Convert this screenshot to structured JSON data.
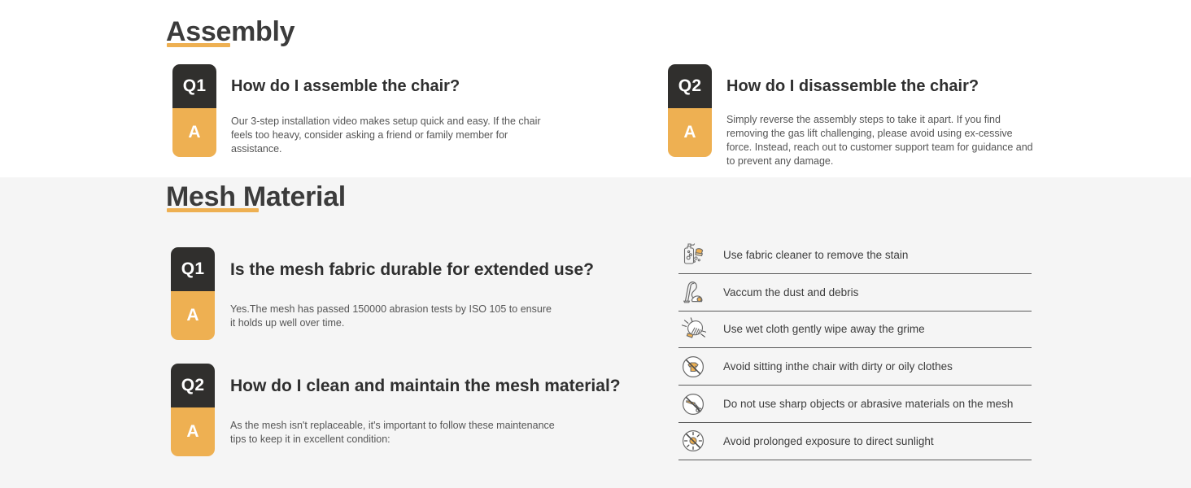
{
  "sections": [
    {
      "id": "assembly",
      "title": "Assembly",
      "accent_color": "#eeb052",
      "background": "#ffffff",
      "cards": [
        {
          "q_label": "Q1",
          "a_label": "A",
          "question": "How do I assemble the chair?",
          "answer": "Our 3-step installation video makes setup quick and easy. If the chair feels too heavy, consider asking a friend or family member for assistance."
        },
        {
          "q_label": "Q2",
          "a_label": "A",
          "question": "How do I disassemble the chair?",
          "answer": "Simply reverse the assembly steps to take it apart. If you find removing the gas lift challenging, please avoid using ex-cessive force. Instead, reach out to  customer support team for guidance and to prevent any damage."
        }
      ]
    },
    {
      "id": "mesh-material",
      "title": "Mesh Material",
      "accent_color": "#eeb052",
      "background": "#f5f5f5",
      "cards": [
        {
          "q_label": "Q1",
          "a_label": "A",
          "question": "Is the mesh fabric durable for extended use?",
          "answer": "Yes.The mesh has passed 150000 abrasion tests by ISO 105 to ensure it holds up well over time."
        },
        {
          "q_label": "Q2",
          "a_label": "A",
          "question": "How do I  clean and maintain the mesh material?",
          "answer": "As the mesh isn't replaceable, it's important to follow these maintenance tips to keep it in excellent condition:"
        }
      ]
    }
  ],
  "maintenance_tips": [
    {
      "icon": "spray-bottle-sponge-icon",
      "label": "Use fabric cleaner to remove the stain"
    },
    {
      "icon": "vacuum-cleaner-icon",
      "label": "Vaccum the dust and debris"
    },
    {
      "icon": "hand-wiping-cloth-icon",
      "label": "Use wet cloth gently wipe away the grime"
    },
    {
      "icon": "no-dirty-clothes-icon",
      "label": "Avoid sitting inthe chair with dirty or oily clothes"
    },
    {
      "icon": "no-sharp-objects-icon",
      "label": "Do not use sharp objects or abrasive materials on the mesh"
    },
    {
      "icon": "no-direct-sunlight-icon",
      "label": "Avoid prolonged exposure to direct sunlight"
    }
  ],
  "colors": {
    "badge_question_bg": "#302f2d",
    "badge_answer_bg": "#eeb052",
    "accent": "#eeb052",
    "heading_text": "#3b3b3b",
    "body_text": "#555555",
    "section_alt_bg": "#f5f5f5",
    "divider": "#5a5a5a"
  }
}
